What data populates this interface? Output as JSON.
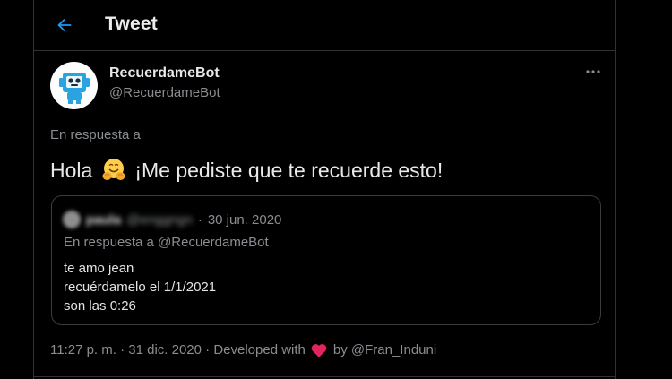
{
  "header": {
    "title": "Tweet",
    "back_icon": "arrow-left-icon"
  },
  "tweet": {
    "display_name": "RecuerdameBot",
    "handle": "@RecuerdameBot",
    "reply_label": "En respuesta a",
    "text_before_emoji": "Hola",
    "emoji": "hugging-face-emoji",
    "text_after_emoji": "¡Me pediste que te recuerde esto!",
    "more_icon": "more-horizontal-icon"
  },
  "quote": {
    "name_blurred": "paula",
    "handle_blurred": "@enggngn",
    "separator": "·",
    "date": "30 jun. 2020",
    "reply_label": "En respuesta a @RecuerdameBot",
    "lines": [
      "te amo jean",
      "recuérdamelo el 1/1/2021",
      "son las 0:26"
    ]
  },
  "meta": {
    "time_date": "11:27 p. m. · 31 dic. 2020 · Developed with",
    "heart_icon": "heart-icon",
    "by_text": "by @Fran_Induni"
  },
  "colors": {
    "background": "#000000",
    "accent": "#1d9bf0",
    "heart": "#e0245e",
    "border": "#2f3336",
    "secondary_text": "#8a8d91"
  }
}
